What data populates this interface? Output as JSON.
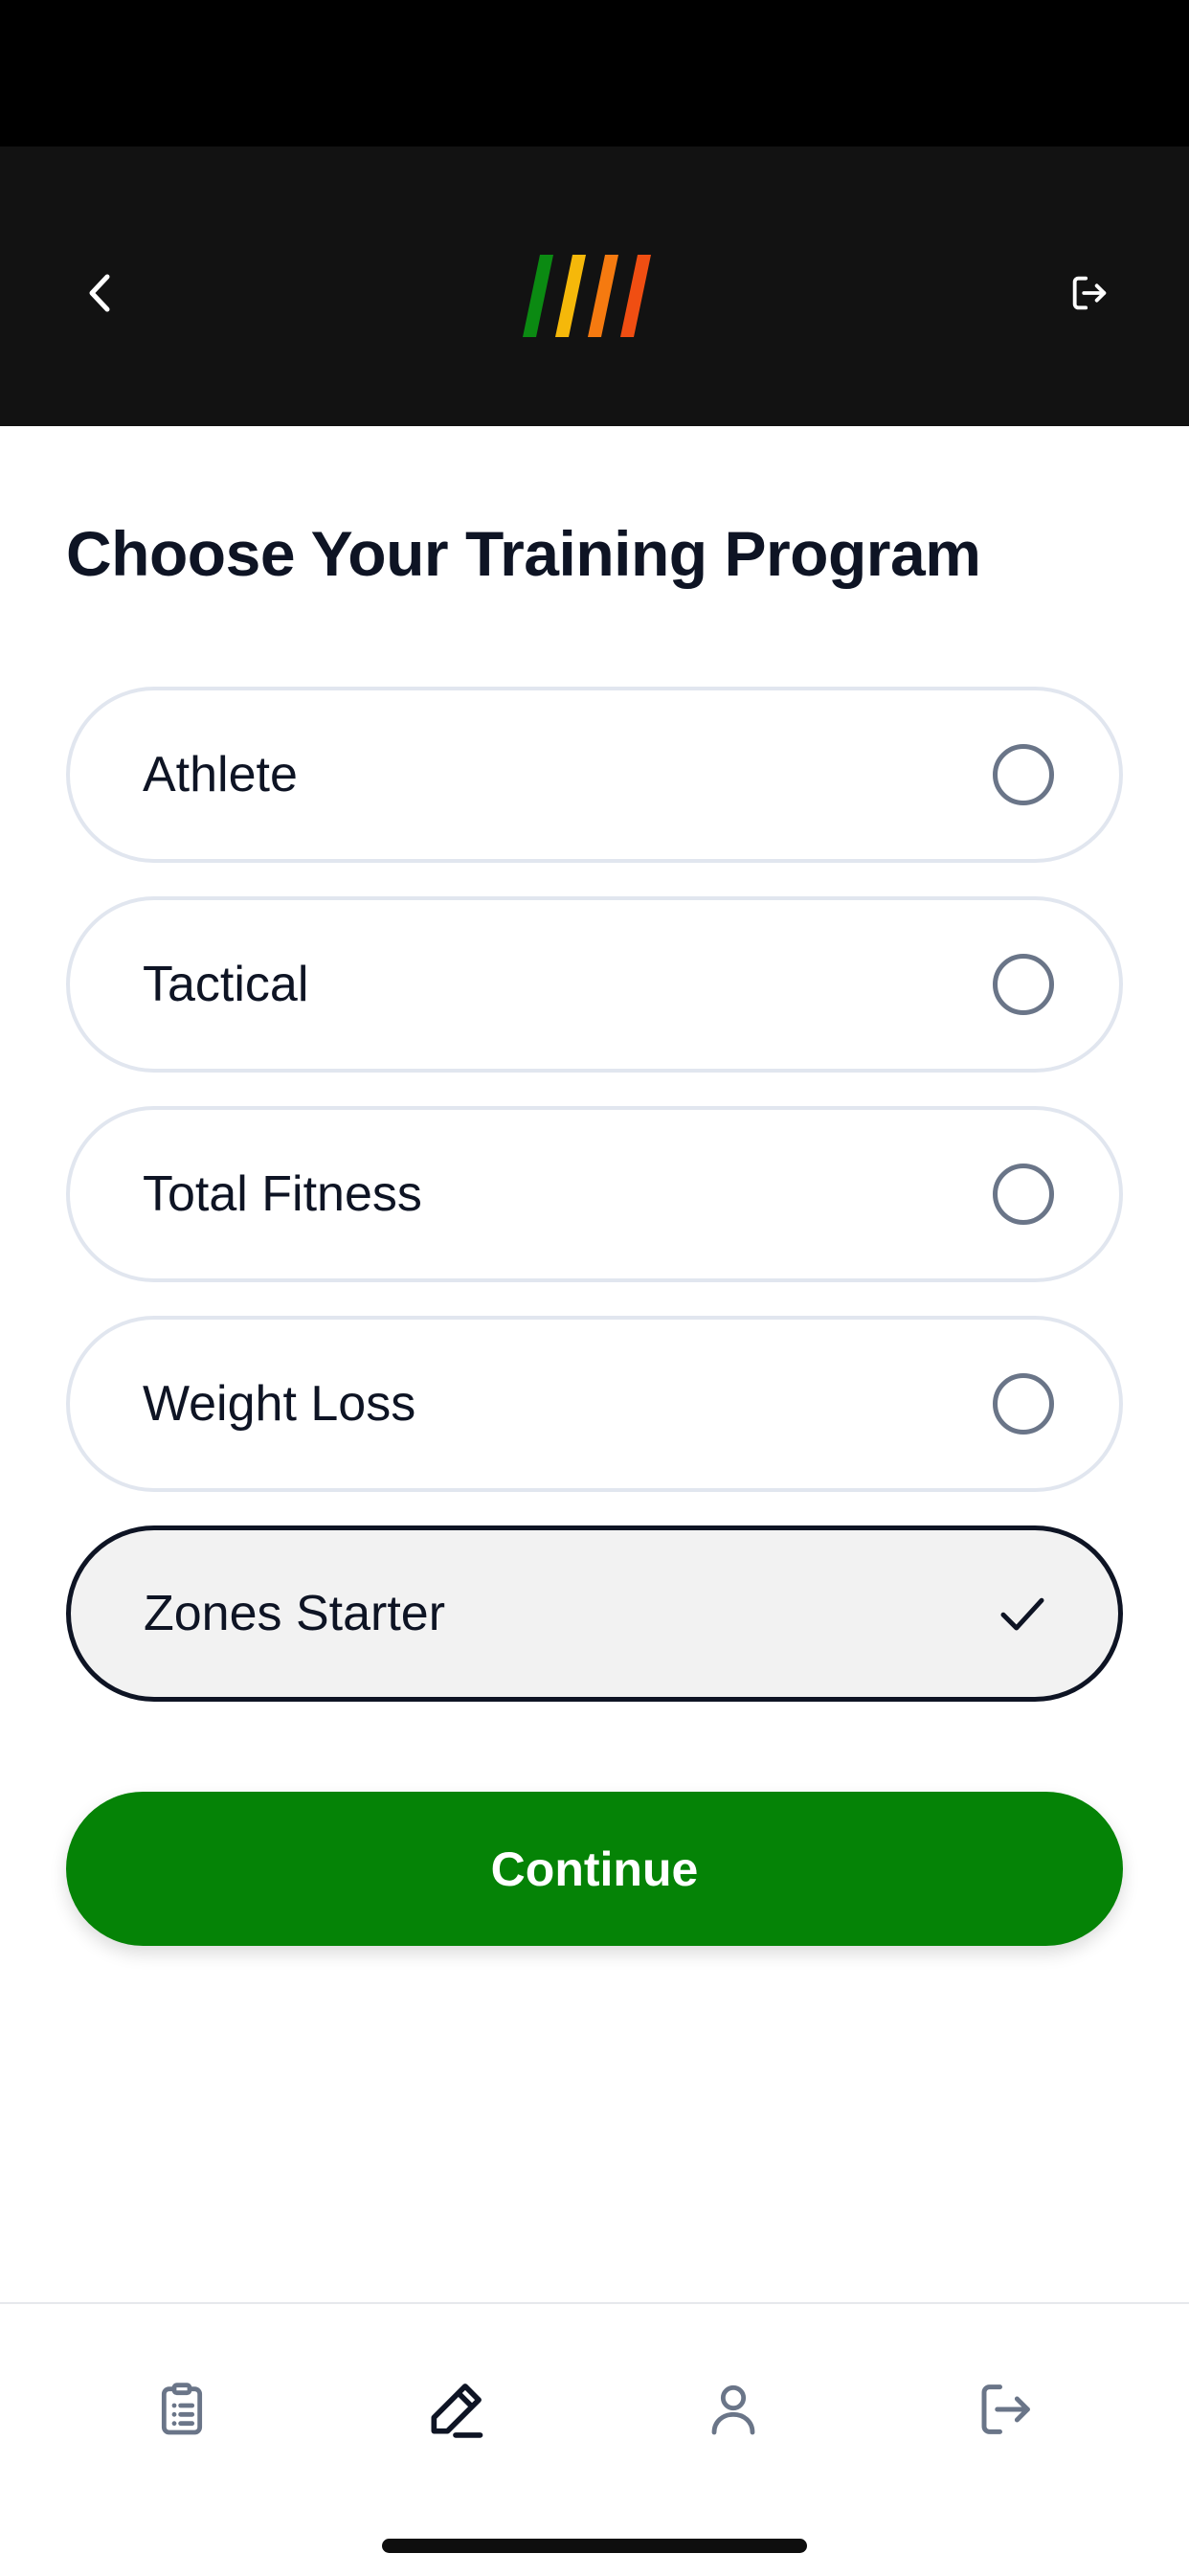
{
  "header": {
    "back_icon": "chevron-left-icon",
    "logo": "brand-stripes-logo",
    "logo_colors": [
      "#0b8a12",
      "#f5b80a",
      "#f57a10",
      "#f04e12"
    ],
    "logout_icon": "logout-icon"
  },
  "page": {
    "title": "Choose Your Training Program"
  },
  "programs": [
    {
      "label": "Athlete",
      "selected": false
    },
    {
      "label": "Tactical",
      "selected": false
    },
    {
      "label": "Total Fitness",
      "selected": false
    },
    {
      "label": "Weight Loss",
      "selected": false
    },
    {
      "label": "Zones Starter",
      "selected": true
    }
  ],
  "actions": {
    "continue_label": "Continue"
  },
  "bottom_nav": {
    "items": [
      {
        "icon": "clipboard-icon",
        "active": false
      },
      {
        "icon": "pencil-icon",
        "active": true
      },
      {
        "icon": "user-icon",
        "active": false
      },
      {
        "icon": "logout-icon",
        "active": false
      }
    ]
  },
  "colors": {
    "accent_green": "#058306",
    "text_dark": "#0e1424",
    "muted_icon": "#6a7588",
    "border_light": "#e1e6ef",
    "selected_bg": "#f2f2f2",
    "header_bg": "#121212"
  }
}
